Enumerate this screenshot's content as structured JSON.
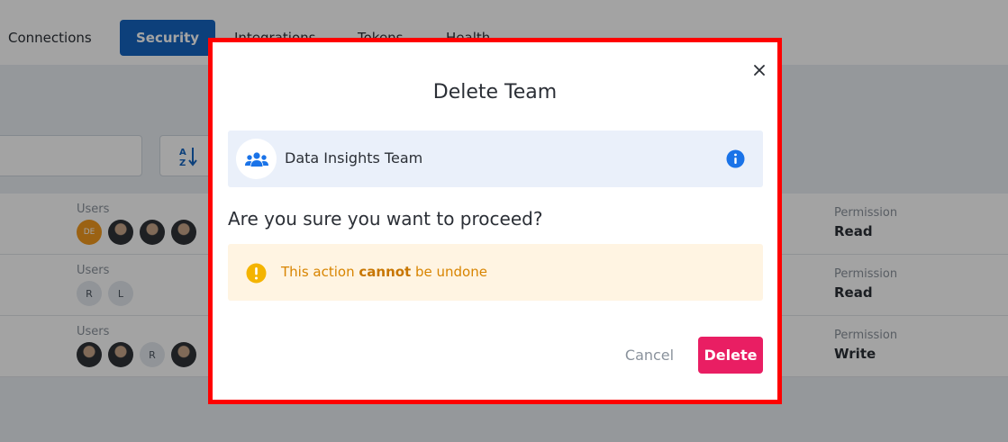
{
  "tabs": [
    {
      "label": "Connections",
      "active": false
    },
    {
      "label": "Security",
      "active": true
    },
    {
      "label": "Integrations",
      "active": false
    },
    {
      "label": "Tokens",
      "active": false
    },
    {
      "label": "Health",
      "active": false
    }
  ],
  "rows": [
    {
      "users_label": "Users",
      "avatars": [
        "DE",
        "photo",
        "photo",
        "photo"
      ],
      "permission_label": "Permission",
      "permission": "Read"
    },
    {
      "users_label": "Users",
      "avatars": [
        "R",
        "L"
      ],
      "permission_label": "Permission",
      "permission": "Read"
    },
    {
      "users_label": "Users",
      "avatars": [
        "photo",
        "photo",
        "R",
        "photo"
      ],
      "permission_label": "Permission",
      "permission": "Write"
    }
  ],
  "modal": {
    "title": "Delete Team",
    "team_name": "Data Insights Team",
    "question": "Are you sure you want to proceed?",
    "warning": {
      "prefix": "This action ",
      "emphasis": "cannot",
      "suffix": " be undone"
    },
    "cancel_label": "Cancel",
    "delete_label": "Delete",
    "close_icon": "close-icon",
    "team_icon": "team-group-icon",
    "info_icon": "info-icon",
    "warning_icon": "warning-icon"
  },
  "colors": {
    "primary": "#1565c0",
    "danger": "#e91e63",
    "warning": "#f4b400",
    "info": "#1a73e8",
    "highlight_border": "#ff0000"
  }
}
